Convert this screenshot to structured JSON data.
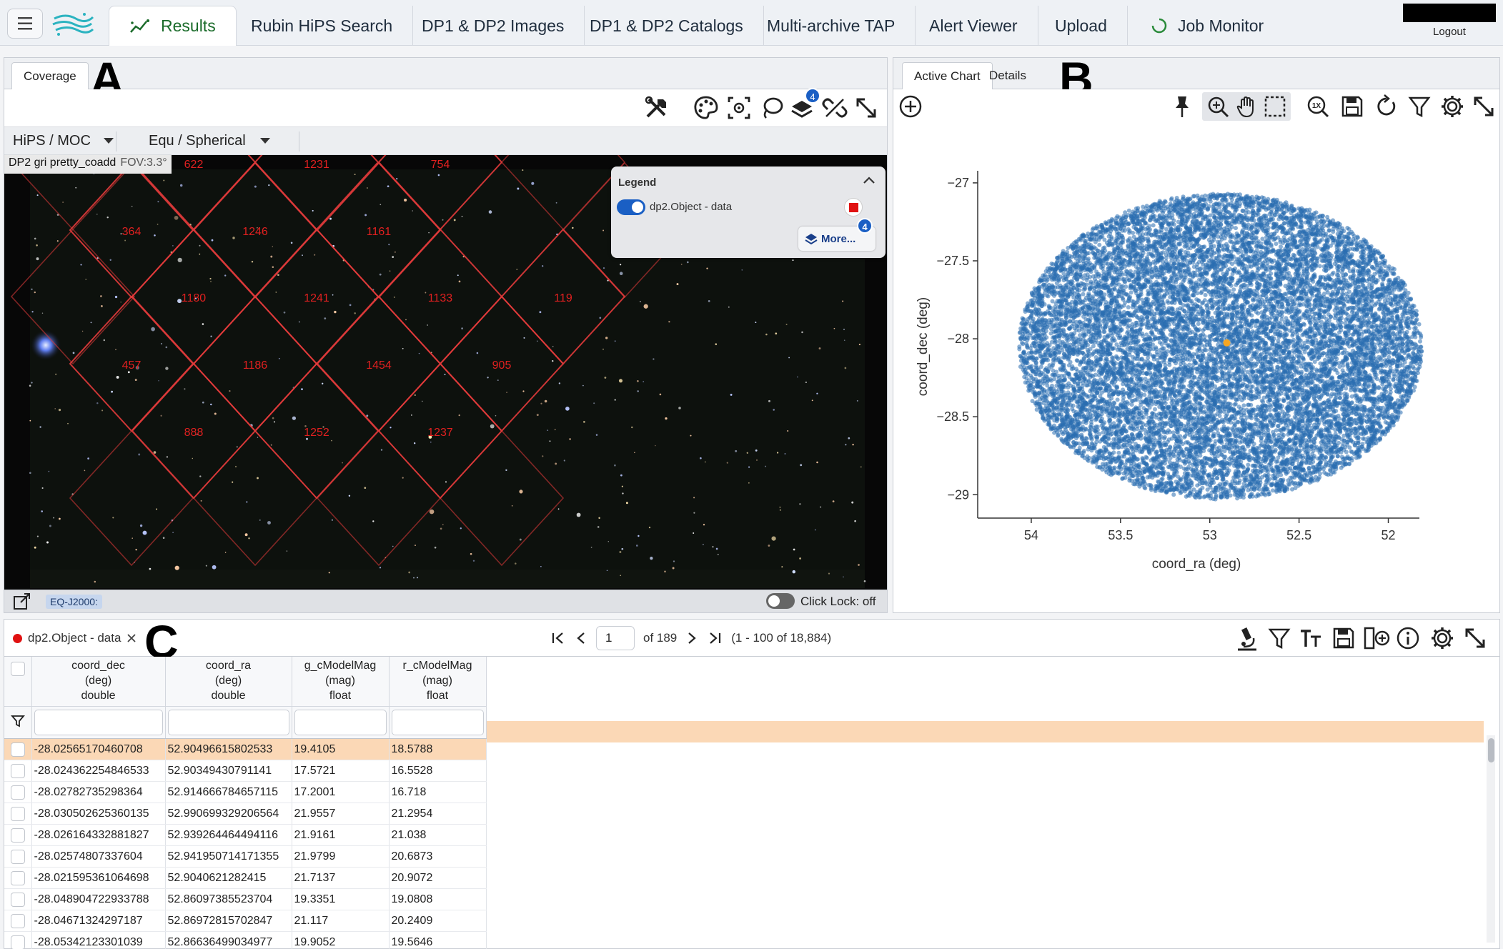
{
  "nav": {
    "tabs": [
      {
        "label": "Results"
      },
      {
        "label": "Rubin HiPS Search"
      },
      {
        "label": "DP1 & DP2 Images"
      },
      {
        "label": "DP1 & DP2 Catalogs"
      },
      {
        "label": "Multi-archive TAP"
      },
      {
        "label": "Alert Viewer"
      },
      {
        "label": "Upload"
      },
      {
        "label": "Job Monitor"
      }
    ],
    "logout_label": "Logout"
  },
  "panel_a": {
    "annotation": "A",
    "tab": "Coverage",
    "hips_dropdown": "HiPS / MOC",
    "projection_dropdown": "Equ / Spherical",
    "image_label": "DP2 gri pretty_coadd",
    "fov": "FOV:3.3°",
    "layers_badge": "4",
    "moc_cells": [
      {
        "id": "622",
        "label": "622"
      },
      {
        "id": "1231",
        "label": "1231"
      },
      {
        "id": "754",
        "label": "754"
      },
      {
        "id": "364",
        "label": "364"
      },
      {
        "id": "1246",
        "label": "1246"
      },
      {
        "id": "1161",
        "label": "1161"
      },
      {
        "id": "1180",
        "label": "1180"
      },
      {
        "id": "1241",
        "label": "1241"
      },
      {
        "id": "1133",
        "label": "1133"
      },
      {
        "id": "119",
        "label": "119"
      },
      {
        "id": "457",
        "label": "457"
      },
      {
        "id": "1186",
        "label": "1186"
      },
      {
        "id": "1454",
        "label": "1454"
      },
      {
        "id": "905",
        "label": "905"
      },
      {
        "id": "888",
        "label": "888"
      },
      {
        "id": "1252",
        "label": "1252"
      },
      {
        "id": "1237",
        "label": "1237"
      }
    ],
    "legend": {
      "title": "Legend",
      "layer": "dp2.Object - data",
      "layer_color": "#e01111",
      "more_label": "More...",
      "more_badge": "4"
    },
    "coord_system": "EQ-J2000:",
    "click_lock": "Click Lock: off"
  },
  "panel_b": {
    "annotation": "B",
    "tabs": [
      "Active Chart",
      "Details"
    ],
    "chart_data": {
      "type": "scatter",
      "xlabel": "coord_ra (deg)",
      "ylabel": "coord_dec (deg)",
      "xlim": [
        54.3,
        51.85
      ],
      "ylim": [
        -29.15,
        -26.95
      ],
      "xticks": [
        "54",
        "53.5",
        "53",
        "52.5",
        "52"
      ],
      "yticks": [
        "−27",
        "−27.5",
        "−28",
        "−28.5",
        "−29"
      ],
      "series": [
        {
          "points_summary": {
            "type": "disk",
            "center_ra": 52.94,
            "center_dec": -28.05,
            "radius_ra": 1.13,
            "radius_dec": 0.98,
            "count": 18884
          },
          "color": "#2a6db0"
        },
        {
          "points": [
            [
              52.905,
              -28.026
            ]
          ],
          "color": "#f5a623"
        }
      ]
    }
  },
  "panel_c": {
    "annotation": "C",
    "tab": "dp2.Object - data",
    "page": "1",
    "of_pages": "of 189",
    "range": "(1 - 100 of 18,884)",
    "columns": [
      {
        "name": "coord_dec",
        "unit": "(deg)",
        "type": "double"
      },
      {
        "name": "coord_ra",
        "unit": "(deg)",
        "type": "double"
      },
      {
        "name": "g_cModelMag",
        "unit": "(mag)",
        "type": "float"
      },
      {
        "name": "r_cModelMag",
        "unit": "(mag)",
        "type": "float"
      }
    ],
    "rows": [
      [
        "-28.02565170460708",
        "52.90496615802533",
        "19.4105",
        "18.5788"
      ],
      [
        "-28.024362254846533",
        "52.90349430791141",
        "17.5721",
        "16.5528"
      ],
      [
        "-28.02782735298364",
        "52.914666784657115",
        "17.2001",
        "16.718"
      ],
      [
        "-28.030502625360135",
        "52.990699329206564",
        "21.9557",
        "21.2954"
      ],
      [
        "-28.026164332881827",
        "52.939264464494116",
        "21.9161",
        "21.038"
      ],
      [
        "-28.02574807337604",
        "52.941950714171355",
        "21.9799",
        "20.6873"
      ],
      [
        "-28.021595361064698",
        "52.9040621282415",
        "21.7137",
        "20.9072"
      ],
      [
        "-28.048904722933788",
        "52.86097385523704",
        "19.3351",
        "19.0808"
      ],
      [
        "-28.04671324297187",
        "52.86972815702847",
        "21.117",
        "20.2409"
      ],
      [
        "-28.05342123301039",
        "52.86636499034977",
        "19.9052",
        "19.5646"
      ]
    ]
  }
}
